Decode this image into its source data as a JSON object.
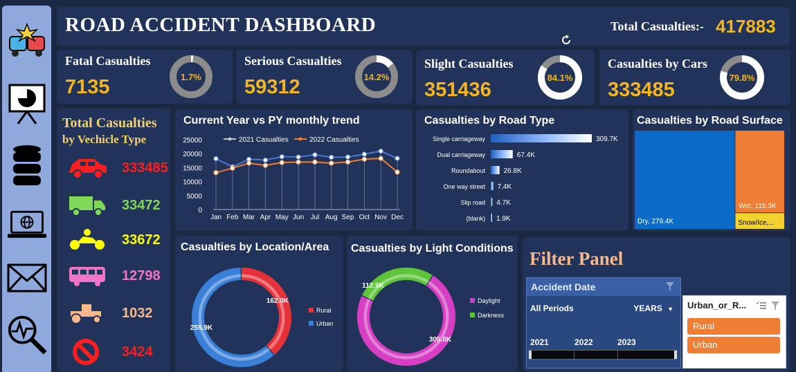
{
  "header": {
    "title": "ROAD ACCIDENT DASHBOARD",
    "total_label": "Total Casualties:-",
    "total_value": "417883"
  },
  "sidebar": {
    "icons": [
      "crash-car-icon",
      "presentation-chart-icon",
      "database-icon",
      "laptop-globe-icon",
      "envelope-icon",
      "search-analytics-icon"
    ]
  },
  "kpis": [
    {
      "label": "Fatal Casualties",
      "value": "7135",
      "pct": "1.7%",
      "fraction": 0.017
    },
    {
      "label": "Serious Casualties",
      "value": "59312",
      "pct": "14.2%",
      "fraction": 0.142
    },
    {
      "label": "Slight Casualties",
      "value": "351436",
      "pct": "84.1%",
      "fraction": 0.841
    },
    {
      "label": "Casualties by Cars",
      "value": "333485",
      "pct": "79.8%",
      "fraction": 0.798
    }
  ],
  "vehicle_panel": {
    "title1": "Total Casualties",
    "title2": "by Vechicle Type",
    "items": [
      {
        "icon": "car-icon",
        "value": "333485",
        "color": "#ff1f1f"
      },
      {
        "icon": "truck-icon",
        "value": "33472",
        "color": "#7fd857"
      },
      {
        "icon": "motorcycle-icon",
        "value": "33672",
        "color": "#ffff00"
      },
      {
        "icon": "bus-icon",
        "value": "12798",
        "color": "#f274c8"
      },
      {
        "icon": "tractor-icon",
        "value": "1032",
        "color": "#f8b88b"
      },
      {
        "icon": "no-entry-icon",
        "value": "3424",
        "color": "#ff1f1f"
      }
    ]
  },
  "charts": {
    "monthly": {
      "title": "Current Year vs PY monthly trend",
      "chart_data": {
        "type": "line",
        "categories": [
          "Jan",
          "Feb",
          "Mar",
          "Apr",
          "May",
          "Jun",
          "Jul",
          "Aug",
          "Sep",
          "Oct",
          "Nov",
          "Dec"
        ],
        "series": [
          {
            "name": "2021 Casualties",
            "values": [
              18200,
              15300,
              18000,
              17700,
              18900,
              18800,
              19600,
              18700,
              18800,
              19800,
              20900,
              18300
            ],
            "color": "#bcc6d6"
          },
          {
            "name": "2022 Casualties",
            "values": [
              13200,
              14800,
              16600,
              15800,
              16800,
              17000,
              17000,
              16600,
              17000,
              18000,
              18300,
              13400
            ],
            "color": "#ef7d33"
          }
        ],
        "yticks": [
          0,
          5000,
          10000,
          15000,
          20000,
          25000
        ],
        "ylim": [
          0,
          25000
        ]
      }
    },
    "road_type": {
      "title": "Casualties by Road Type",
      "chart_data": {
        "type": "bar",
        "categories": [
          "Single carriageway",
          "Dual carriageway",
          "Roundabout",
          "One way street",
          "Slip road",
          "(blank)"
        ],
        "values": [
          309.7,
          67.4,
          26.8,
          7.4,
          4.7,
          1.9
        ],
        "labels": [
          "309.7K",
          "67.4K",
          "26.8K",
          "7.4K",
          "4.7K",
          "1.9K"
        ]
      }
    },
    "road_surface": {
      "title": "Casualties by Road Surface",
      "chart_data": {
        "type": "treemap",
        "items": [
          {
            "label": "Dry, 279.4K",
            "value": 279.4,
            "color": "#0b6bc8"
          },
          {
            "label": "Wet, 115.3K",
            "value": 115.3,
            "color": "#ef7d33"
          },
          {
            "label": "Snow/Ice,...",
            "value": 23.2,
            "color": "#f2d22e"
          }
        ]
      }
    },
    "location": {
      "title": "Casualties by Location/Area",
      "chart_data": {
        "type": "pie",
        "labels": [
          "Rural",
          "Urban"
        ],
        "values": [
          162.0,
          255.9
        ],
        "value_labels": [
          "162.0K",
          "255.9K"
        ],
        "colors": [
          "#e5323a",
          "#3a7fd8"
        ]
      }
    },
    "light": {
      "title": "Casualties by Light Conditions",
      "chart_data": {
        "type": "pie",
        "labels": [
          "Daylight",
          "Darkness"
        ],
        "values": [
          305.0,
          112.9
        ],
        "value_labels": [
          "305.0K",
          "112.9K"
        ],
        "colors": [
          "#d63fc4",
          "#5ec43a"
        ]
      }
    }
  },
  "filter": {
    "title": "Filter Panel",
    "date_slicer": {
      "title": "Accident Date",
      "period": "All Periods",
      "unit": "YEARS",
      "years": [
        "2021",
        "2022",
        "2023"
      ]
    },
    "area_slicer": {
      "title": "Urban_or_R...",
      "options": [
        "Rural",
        "Urban"
      ]
    }
  }
}
